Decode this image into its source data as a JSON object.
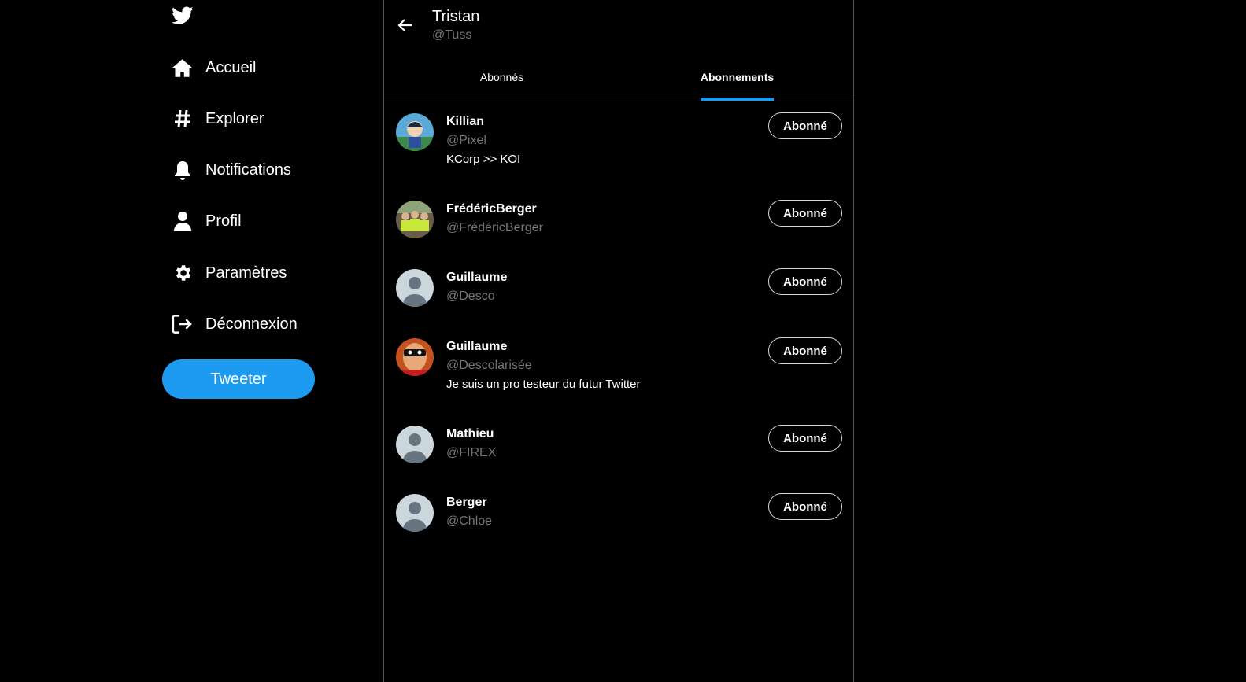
{
  "sidebar": {
    "logo_icon": "twitter-bird-icon",
    "items": [
      {
        "label": "Accueil",
        "icon": "home-icon"
      },
      {
        "label": "Explorer",
        "icon": "hashtag-icon"
      },
      {
        "label": "Notifications",
        "icon": "bell-icon"
      },
      {
        "label": "Profil",
        "icon": "person-icon"
      },
      {
        "label": "Paramètres",
        "icon": "gear-icon"
      },
      {
        "label": "Déconnexion",
        "icon": "logout-icon"
      }
    ],
    "tweet_label": "Tweeter"
  },
  "header": {
    "name": "Tristan",
    "handle": "@Tuss"
  },
  "tabs": [
    {
      "label": "Abonnés",
      "active": false
    },
    {
      "label": "Abonnements",
      "active": true
    }
  ],
  "users": [
    {
      "name": "Killian",
      "handle": "@Pixel",
      "bio": "KCorp >> KOI",
      "button": "Abonné",
      "avatar": "cartoon-boy-avatar"
    },
    {
      "name": "FrédéricBerger",
      "handle": "@FrédéricBerger",
      "bio": "",
      "button": "Abonné",
      "avatar": "group-photo-avatar"
    },
    {
      "name": "Guillaume",
      "handle": "@Desco",
      "bio": "",
      "button": "Abonné",
      "avatar": "default-avatar"
    },
    {
      "name": "Guillaume",
      "handle": "@Descolarisée",
      "bio": "Je suis un pro testeur du futur Twitter",
      "button": "Abonné",
      "avatar": "superhero-avatar"
    },
    {
      "name": "Mathieu",
      "handle": "@FIREX",
      "bio": "",
      "button": "Abonné",
      "avatar": "default-avatar"
    },
    {
      "name": "Berger",
      "handle": "@Chloe",
      "bio": "",
      "button": "Abonné",
      "avatar": "default-avatar"
    }
  ],
  "colors": {
    "accent": "#1d9bf0",
    "background": "#000000",
    "secondary_text": "#71767b"
  }
}
